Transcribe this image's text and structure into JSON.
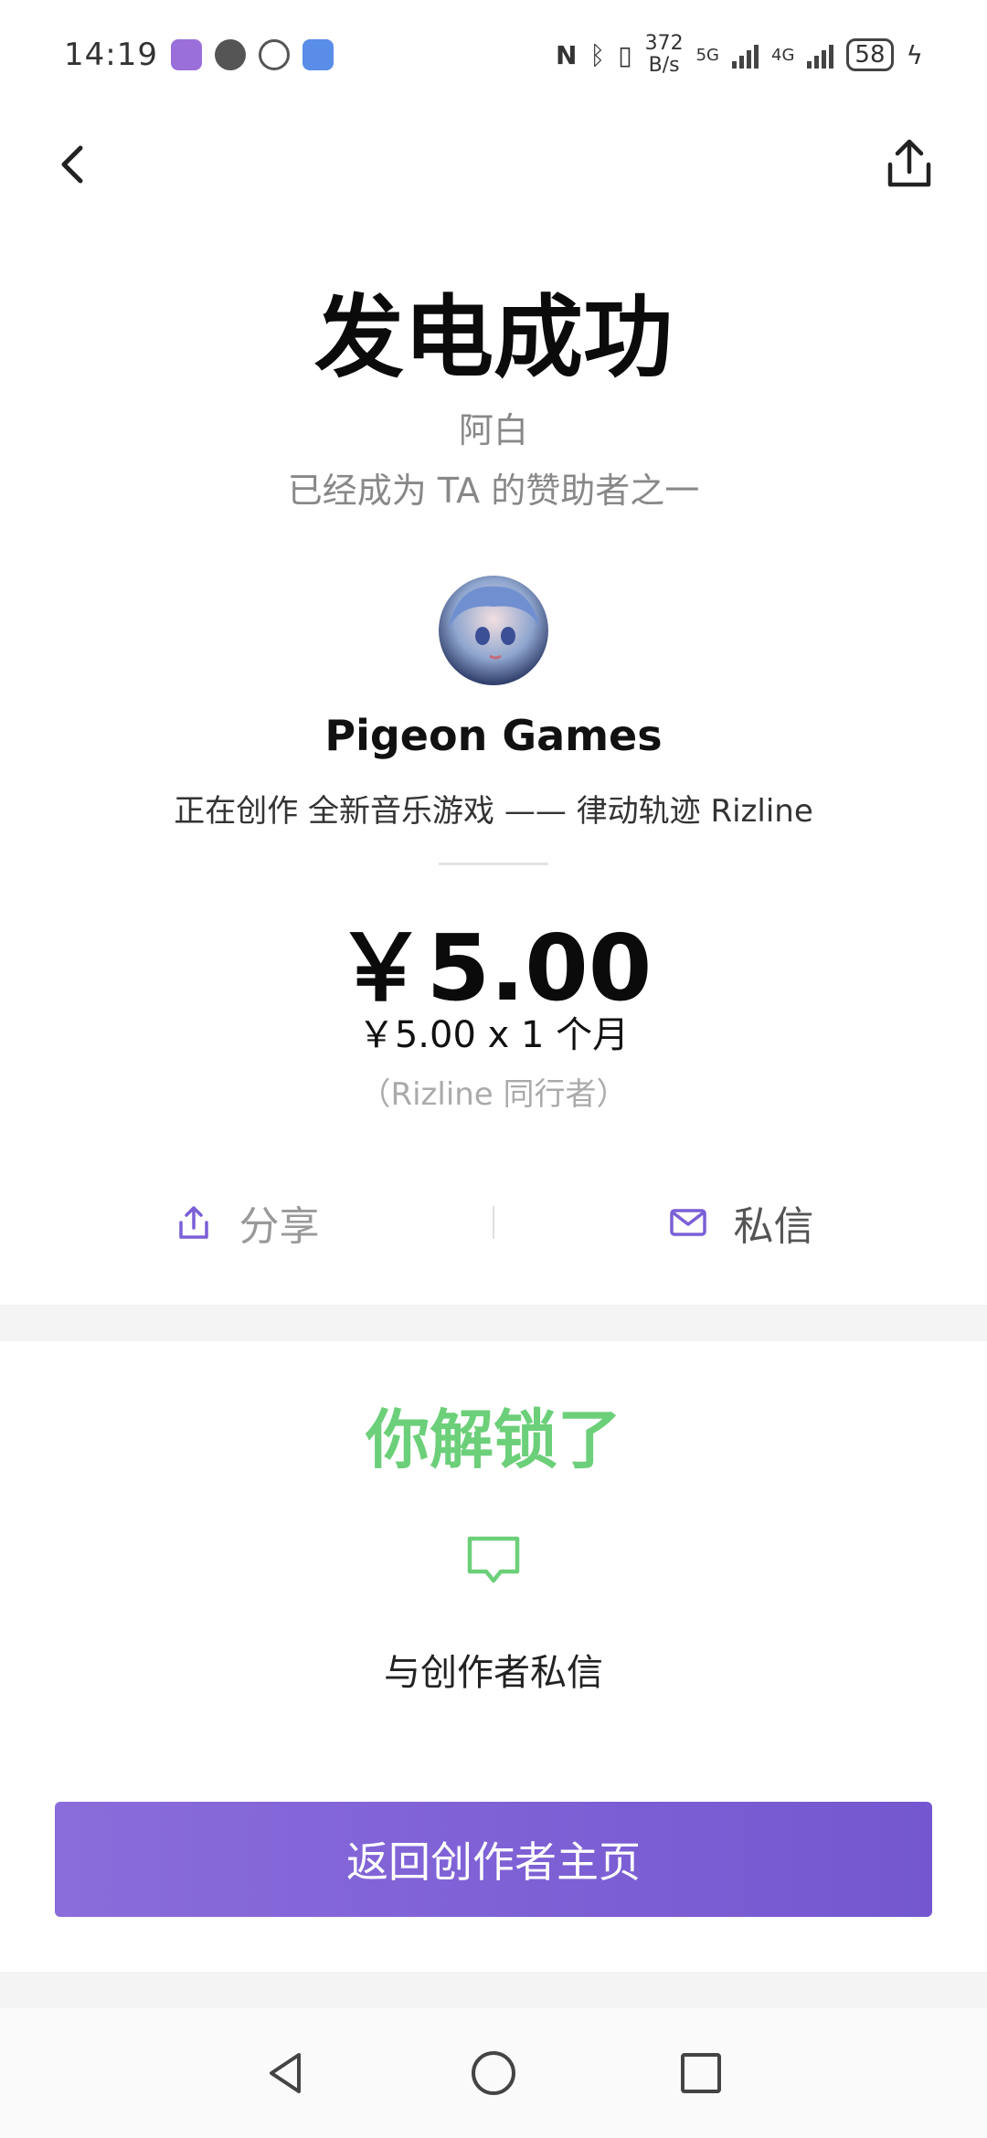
{
  "status_bar": {
    "time": "14:19",
    "speed_value": "372",
    "speed_unit": "B/s",
    "net1": "5G",
    "net2": "4G",
    "battery": "58"
  },
  "header": {
    "back_icon": "chevron-left-icon",
    "share_icon": "share-icon"
  },
  "result": {
    "title": "发电成功",
    "subtitle_name": "阿白",
    "subtitle_line": "已经成为 TA 的赞助者之一"
  },
  "creator": {
    "name": "Pigeon Games",
    "description": "正在创作 全新音乐游戏 —— 律动轨迹 Rizline"
  },
  "payment": {
    "amount": "￥5.00",
    "detail": "￥5.00 x 1 个月",
    "tier": "（Rizline 同行者）"
  },
  "actions": {
    "share_label": "分享",
    "message_label": "私信"
  },
  "unlock": {
    "title": "你解锁了",
    "item_label": "与创作者私信"
  },
  "buttons": {
    "return_label": "返回创作者主页"
  },
  "colors": {
    "accent_purple": "#7b5fd6",
    "unlock_green": "#6ccf79"
  }
}
